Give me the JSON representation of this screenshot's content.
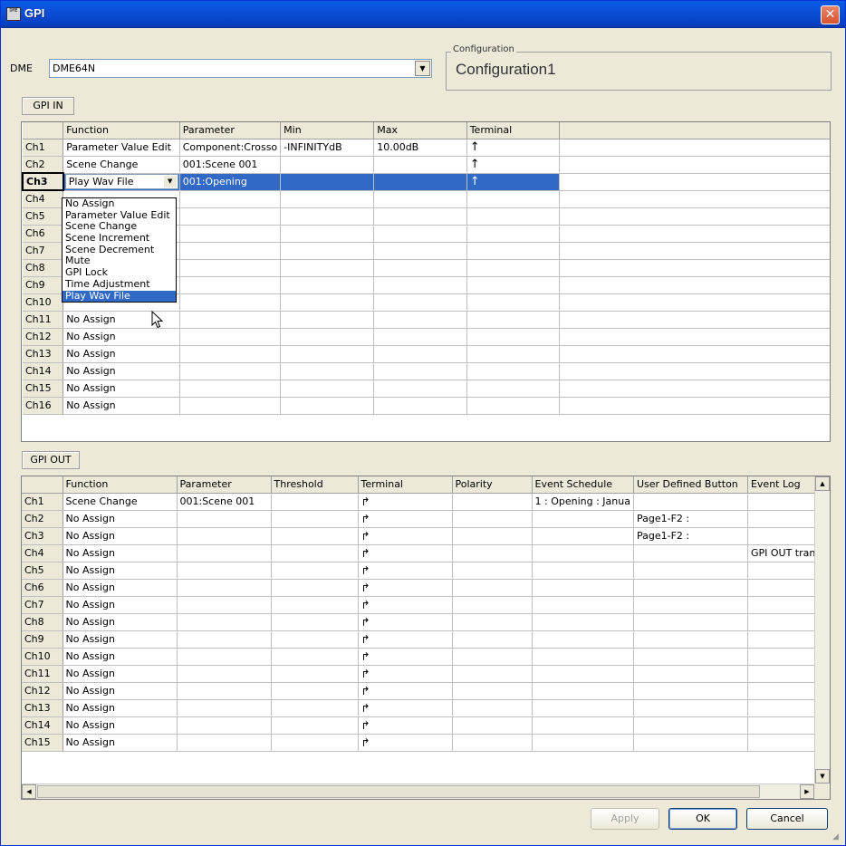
{
  "window": {
    "title": "GPI",
    "icon_text": "DME"
  },
  "dme": {
    "label": "DME",
    "value": "DME64N"
  },
  "configuration": {
    "group_label": "Configuration",
    "value": "Configuration1"
  },
  "gpi_in": {
    "section_label": "GPI IN",
    "columns": [
      "Function",
      "Parameter",
      "Min",
      "Max",
      "Terminal"
    ],
    "rows": [
      {
        "ch": "Ch1",
        "function": "Parameter Value Edit",
        "parameter": "Component:Crosso",
        "min": "-INFINITYdB",
        "max": "10.00dB",
        "terminal": "↑"
      },
      {
        "ch": "Ch2",
        "function": "Scene Change",
        "parameter": "001:Scene 001",
        "min": "",
        "max": "",
        "terminal": "↑"
      },
      {
        "ch": "Ch3",
        "function": "Play Wav File",
        "parameter": "001:Opening",
        "min": "",
        "max": "",
        "terminal": "↑"
      },
      {
        "ch": "Ch4",
        "function": "",
        "parameter": "",
        "min": "",
        "max": "",
        "terminal": ""
      },
      {
        "ch": "Ch5",
        "function": "",
        "parameter": "",
        "min": "",
        "max": "",
        "terminal": ""
      },
      {
        "ch": "Ch6",
        "function": "",
        "parameter": "",
        "min": "",
        "max": "",
        "terminal": ""
      },
      {
        "ch": "Ch7",
        "function": "",
        "parameter": "",
        "min": "",
        "max": "",
        "terminal": ""
      },
      {
        "ch": "Ch8",
        "function": "",
        "parameter": "",
        "min": "",
        "max": "",
        "terminal": ""
      },
      {
        "ch": "Ch9",
        "function": "",
        "parameter": "",
        "min": "",
        "max": "",
        "terminal": ""
      },
      {
        "ch": "Ch10",
        "function": "",
        "parameter": "",
        "min": "",
        "max": "",
        "terminal": ""
      },
      {
        "ch": "Ch11",
        "function": "No Assign",
        "parameter": "",
        "min": "",
        "max": "",
        "terminal": ""
      },
      {
        "ch": "Ch12",
        "function": "No Assign",
        "parameter": "",
        "min": "",
        "max": "",
        "terminal": ""
      },
      {
        "ch": "Ch13",
        "function": "No Assign",
        "parameter": "",
        "min": "",
        "max": "",
        "terminal": ""
      },
      {
        "ch": "Ch14",
        "function": "No Assign",
        "parameter": "",
        "min": "",
        "max": "",
        "terminal": ""
      },
      {
        "ch": "Ch15",
        "function": "No Assign",
        "parameter": "",
        "min": "",
        "max": "",
        "terminal": ""
      },
      {
        "ch": "Ch16",
        "function": "No Assign",
        "parameter": "",
        "min": "",
        "max": "",
        "terminal": ""
      }
    ],
    "selected_row": "Ch3",
    "dropdown_options": [
      "No Assign",
      "Parameter Value Edit",
      "Scene Change",
      "Scene Increment",
      "Scene Decrement",
      "Mute",
      "GPI Lock",
      "Time Adjustment",
      "Play Wav File"
    ],
    "dropdown_highlighted": "Play Wav File"
  },
  "gpi_out": {
    "section_label": "GPI OUT",
    "columns": [
      "Function",
      "Parameter",
      "Threshold",
      "Terminal",
      "Polarity",
      "Event Schedule",
      "User Defined Button",
      "Event Log"
    ],
    "rows": [
      {
        "ch": "Ch1",
        "function": "Scene Change",
        "parameter": "001:Scene 001",
        "threshold": "",
        "terminal": "↱",
        "polarity": "",
        "event_schedule": "1 : Opening : Janua",
        "user_button": "",
        "event_log": ""
      },
      {
        "ch": "Ch2",
        "function": "No Assign",
        "parameter": "",
        "threshold": "",
        "terminal": "↱",
        "polarity": "",
        "event_schedule": "",
        "user_button": "Page1-F2 :",
        "event_log": ""
      },
      {
        "ch": "Ch3",
        "function": "No Assign",
        "parameter": "",
        "threshold": "",
        "terminal": "↱",
        "polarity": "",
        "event_schedule": "",
        "user_button": "Page1-F2 :",
        "event_log": ""
      },
      {
        "ch": "Ch4",
        "function": "No Assign",
        "parameter": "",
        "threshold": "",
        "terminal": "↱",
        "polarity": "",
        "event_schedule": "",
        "user_button": "",
        "event_log": "GPI OUT trans"
      },
      {
        "ch": "Ch5",
        "function": "No Assign",
        "parameter": "",
        "threshold": "",
        "terminal": "↱",
        "polarity": "",
        "event_schedule": "",
        "user_button": "",
        "event_log": ""
      },
      {
        "ch": "Ch6",
        "function": "No Assign",
        "parameter": "",
        "threshold": "",
        "terminal": "↱",
        "polarity": "",
        "event_schedule": "",
        "user_button": "",
        "event_log": ""
      },
      {
        "ch": "Ch7",
        "function": "No Assign",
        "parameter": "",
        "threshold": "",
        "terminal": "↱",
        "polarity": "",
        "event_schedule": "",
        "user_button": "",
        "event_log": ""
      },
      {
        "ch": "Ch8",
        "function": "No Assign",
        "parameter": "",
        "threshold": "",
        "terminal": "↱",
        "polarity": "",
        "event_schedule": "",
        "user_button": "",
        "event_log": ""
      },
      {
        "ch": "Ch9",
        "function": "No Assign",
        "parameter": "",
        "threshold": "",
        "terminal": "↱",
        "polarity": "",
        "event_schedule": "",
        "user_button": "",
        "event_log": ""
      },
      {
        "ch": "Ch10",
        "function": "No Assign",
        "parameter": "",
        "threshold": "",
        "terminal": "↱",
        "polarity": "",
        "event_schedule": "",
        "user_button": "",
        "event_log": ""
      },
      {
        "ch": "Ch11",
        "function": "No Assign",
        "parameter": "",
        "threshold": "",
        "terminal": "↱",
        "polarity": "",
        "event_schedule": "",
        "user_button": "",
        "event_log": ""
      },
      {
        "ch": "Ch12",
        "function": "No Assign",
        "parameter": "",
        "threshold": "",
        "terminal": "↱",
        "polarity": "",
        "event_schedule": "",
        "user_button": "",
        "event_log": ""
      },
      {
        "ch": "Ch13",
        "function": "No Assign",
        "parameter": "",
        "threshold": "",
        "terminal": "↱",
        "polarity": "",
        "event_schedule": "",
        "user_button": "",
        "event_log": ""
      },
      {
        "ch": "Ch14",
        "function": "No Assign",
        "parameter": "",
        "threshold": "",
        "terminal": "↱",
        "polarity": "",
        "event_schedule": "",
        "user_button": "",
        "event_log": ""
      },
      {
        "ch": "Ch15",
        "function": "No Assign",
        "parameter": "",
        "threshold": "",
        "terminal": "↱",
        "polarity": "",
        "event_schedule": "",
        "user_button": "",
        "event_log": ""
      }
    ]
  },
  "buttons": {
    "apply": "Apply",
    "ok": "OK",
    "cancel": "Cancel"
  },
  "colors": {
    "title_bar": "#0a5ce6",
    "selection": "#3169c6",
    "dialog_bg": "#ece9d8",
    "close_button": "#d7542e"
  },
  "icons": {
    "close": "close-icon",
    "dropdown": "chevron-down-icon",
    "terminal_in": "arrow-up-icon",
    "terminal_out": "arrow-turn-right-icon",
    "cursor": "mouse-pointer-icon"
  }
}
